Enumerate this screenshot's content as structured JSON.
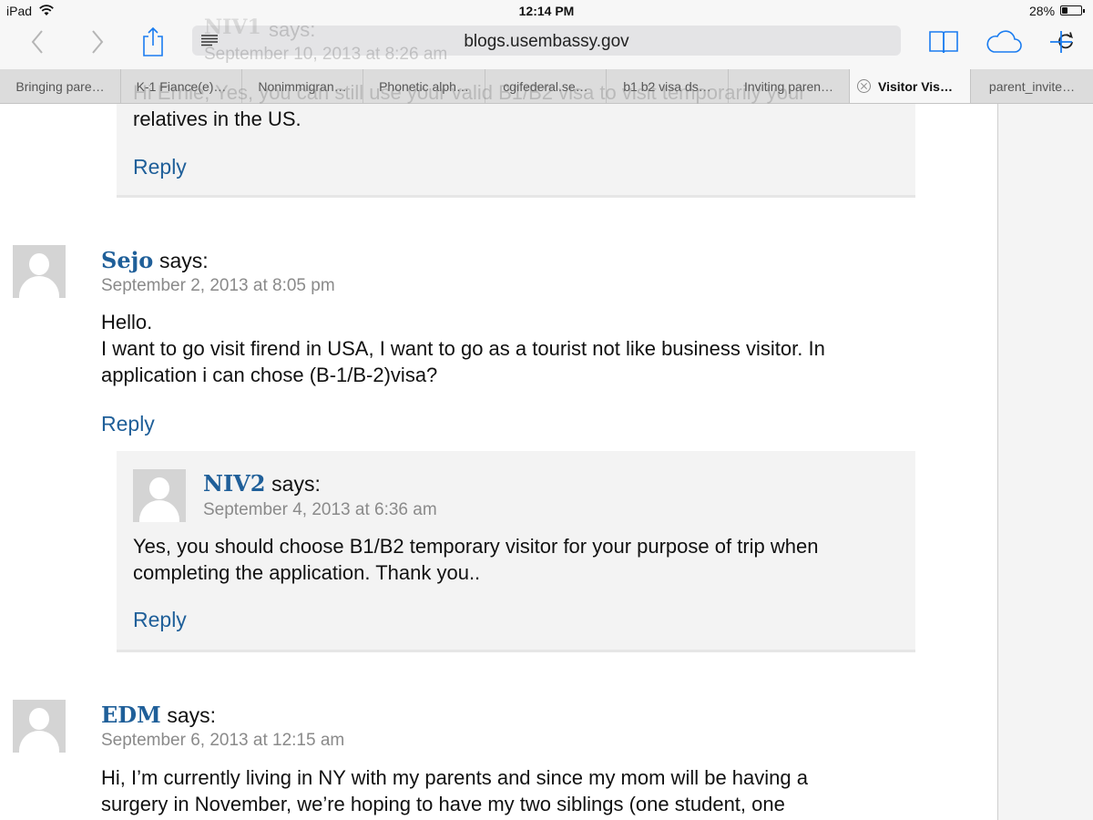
{
  "status_bar": {
    "device": "iPad",
    "time": "12:14 PM",
    "battery": "28%",
    "battery_level": 0.28
  },
  "toolbar": {
    "url": "blogs.usembassy.gov"
  },
  "tabs": [
    {
      "label": "Bringing pare…"
    },
    {
      "label": "K-1 Fiance(e)…"
    },
    {
      "label": "Nonimmigran…"
    },
    {
      "label": "Phonetic alph…"
    },
    {
      "label": "cgifederal.se…"
    },
    {
      "label": "b1 b2 visa ds…"
    },
    {
      "label": "Inviting paren…"
    },
    {
      "label": "Visitor Vis…",
      "active": true
    },
    {
      "label": "parent_invite…"
    }
  ],
  "ghost_overlay": {
    "author": "NIV1",
    "says": "says:",
    "date": "September 10, 2013 at 8:26 am",
    "text": "Hi Ernie, Yes, you can still use your valid B1/B2 visa to visit temporarily your"
  },
  "comments": {
    "prev_reply": {
      "text_tail": "relatives in the US.",
      "reply": "Reply"
    },
    "sejo": {
      "author": "Sejo",
      "says": "says:",
      "date": "September 2, 2013 at 8:05 pm",
      "text": "Hello.\nI want to go visit firend in USA, I want to go as a tourist not like business visitor. In\napplication i can chose (B-1/B-2)visa?",
      "reply": "Reply"
    },
    "niv2": {
      "author": "NIV2",
      "says": "says:",
      "date": "September 4, 2013 at 6:36 am",
      "text": "Yes, you should choose B1/B2 temporary visitor for your purpose of trip when\ncompleting the application. Thank you..",
      "reply": "Reply"
    },
    "edm": {
      "author": "EDM",
      "says": "says:",
      "date": "September 6, 2013 at 12:15 am",
      "text": "Hi, I’m currently living in NY with my parents and since my mom will be having a\nsurgery in November, we’re hoping to have my two siblings (one student, one"
    }
  },
  "colors": {
    "link": "#1f5f99",
    "reply_bg": "#f3f3f3",
    "date": "#8a8a8a"
  }
}
